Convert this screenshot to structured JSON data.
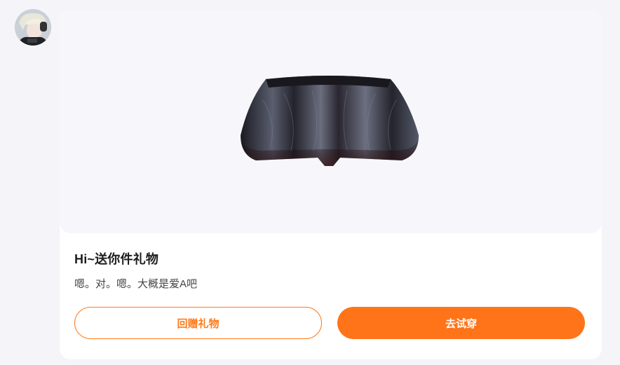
{
  "avatar": {
    "icon": "user-avatar"
  },
  "gift": {
    "image_icon": "bloomers-shorts-icon",
    "title": "Hi~送你件礼物",
    "message": "嗯。对。嗯。大概是爱A吧"
  },
  "actions": {
    "return_gift_label": "回赠礼物",
    "try_on_label": "去试穿"
  },
  "colors": {
    "accent": "#ff7418",
    "background": "#f4f4f9"
  }
}
